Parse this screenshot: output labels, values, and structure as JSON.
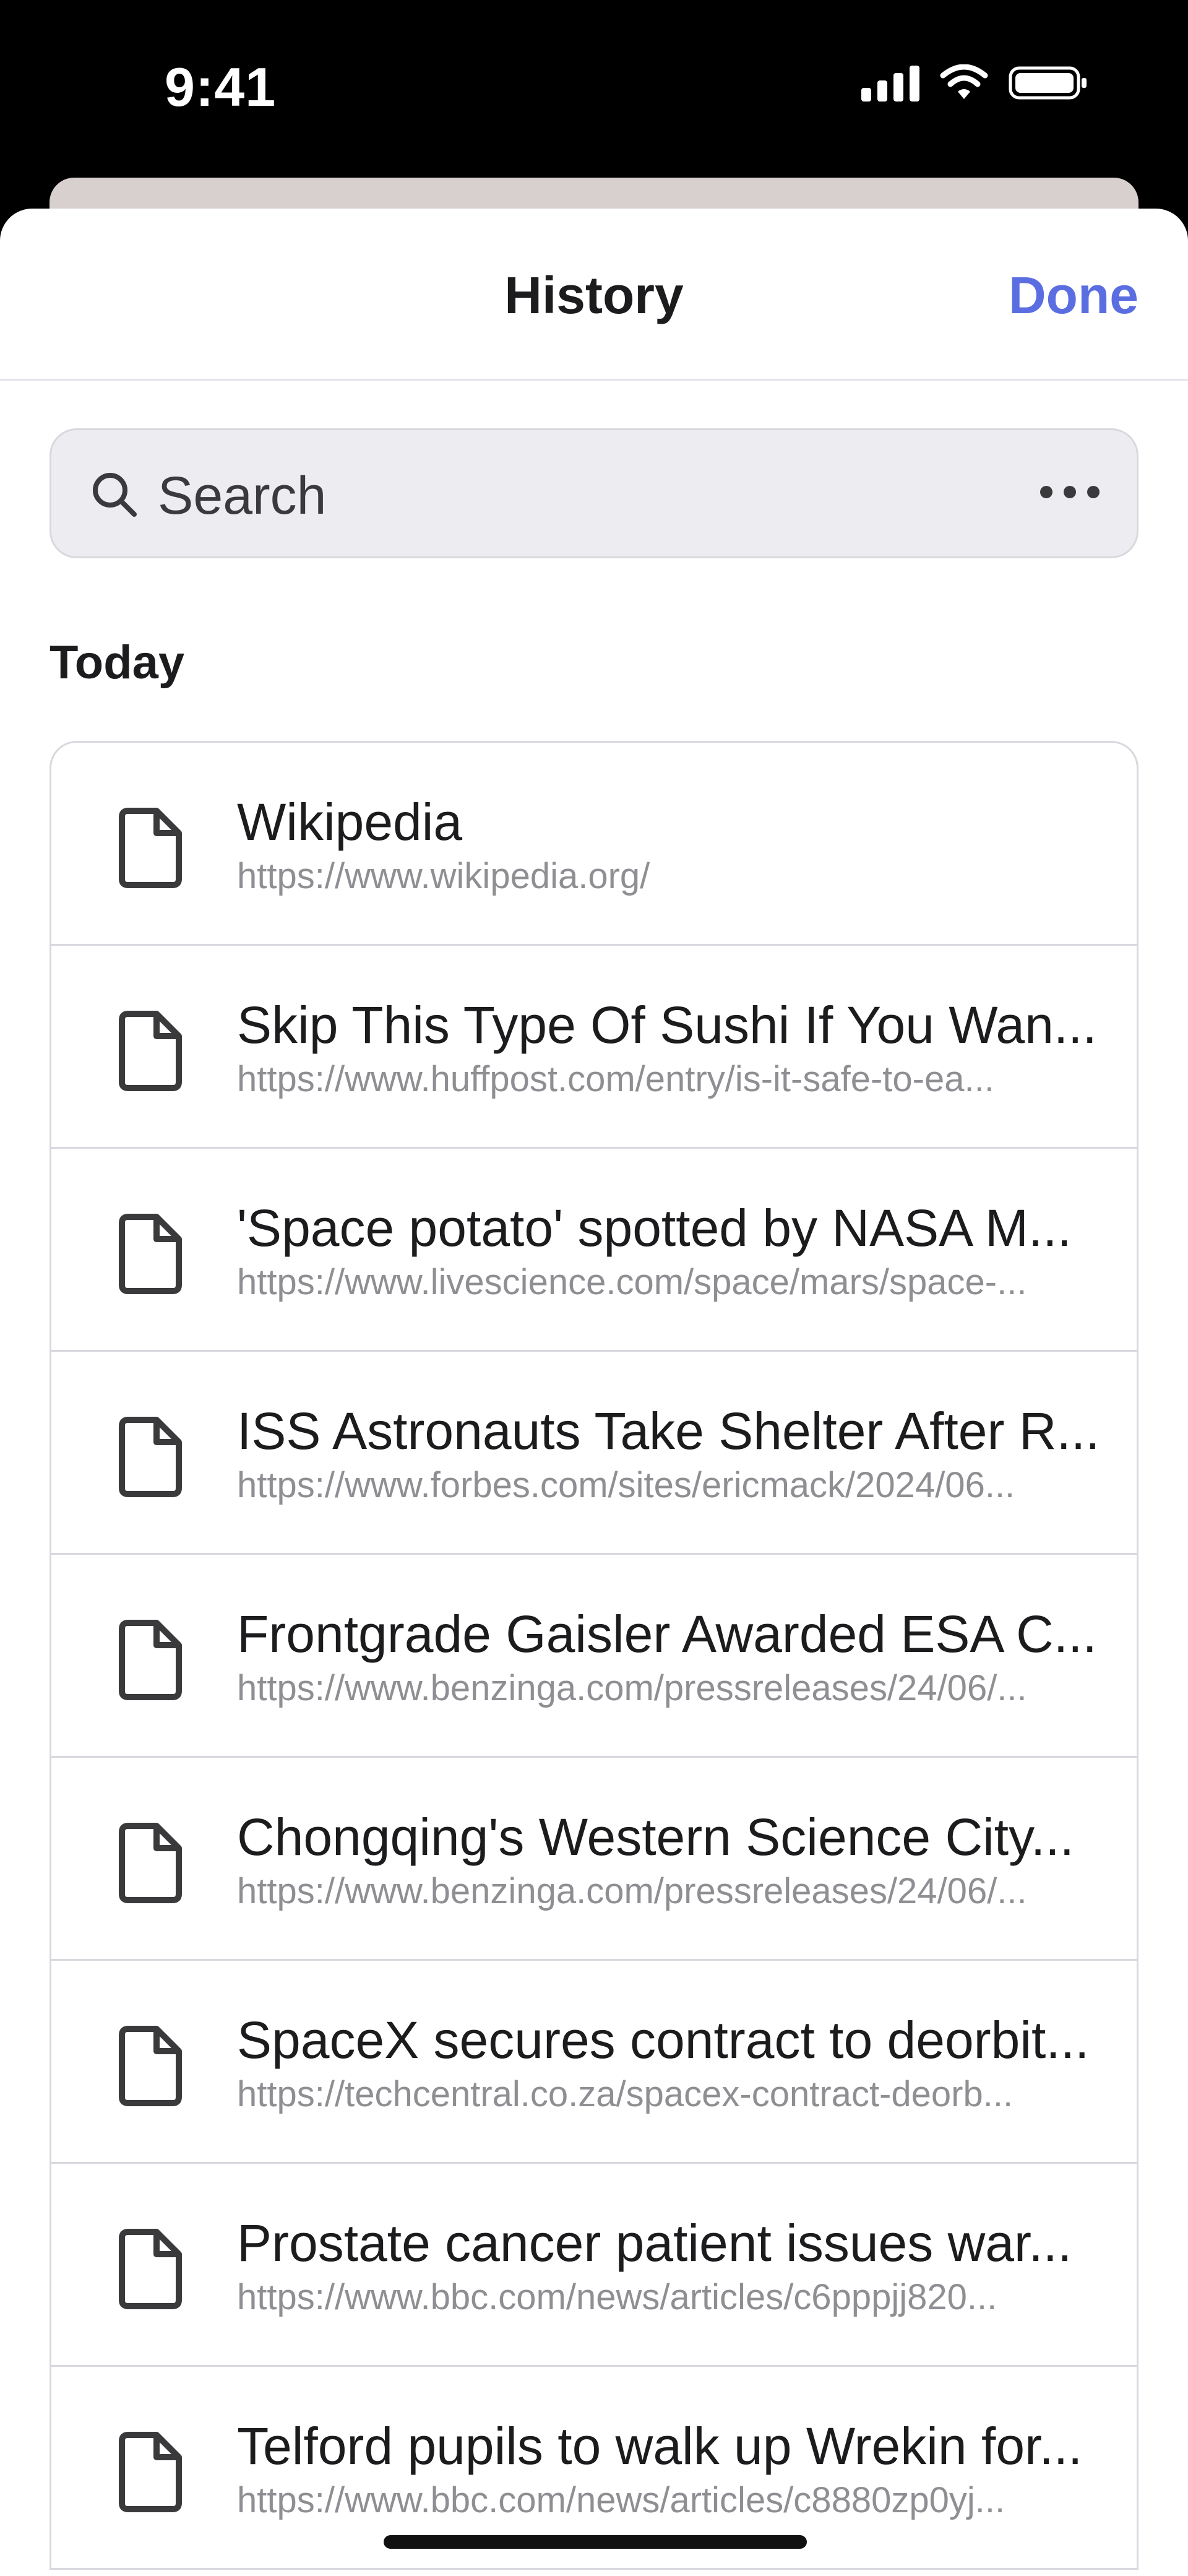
{
  "status_bar": {
    "time": "9:41"
  },
  "nav": {
    "title": "History",
    "done_label": "Done"
  },
  "search": {
    "placeholder": "Search"
  },
  "section": {
    "title": "Today"
  },
  "history": [
    {
      "title": "Wikipedia",
      "url": "https://www.wikipedia.org/"
    },
    {
      "title": "Skip This Type Of Sushi If You Wan...",
      "url": "https://www.huffpost.com/entry/is-it-safe-to-ea..."
    },
    {
      "title": "'Space potato' spotted by NASA M...",
      "url": "https://www.livescience.com/space/mars/space-..."
    },
    {
      "title": "ISS Astronauts Take Shelter After R...",
      "url": "https://www.forbes.com/sites/ericmack/2024/06..."
    },
    {
      "title": "Frontgrade Gaisler Awarded ESA C...",
      "url": "https://www.benzinga.com/pressreleases/24/06/..."
    },
    {
      "title": "Chongqing's Western Science City...",
      "url": "https://www.benzinga.com/pressreleases/24/06/..."
    },
    {
      "title": "SpaceX secures contract to deorbit...",
      "url": "https://techcentral.co.za/spacex-contract-deorb..."
    },
    {
      "title": "Prostate cancer patient issues war...",
      "url": "https://www.bbc.com/news/articles/c6pppjj820..."
    },
    {
      "title": "Telford pupils to walk up Wrekin for...",
      "url": "https://www.bbc.com/news/articles/c8880zp0yj..."
    }
  ],
  "icons": {
    "document": "document-icon",
    "search": "search-icon",
    "more": "more-icon"
  },
  "colors": {
    "accent": "#5b6ee1",
    "secondary_text": "#8e8e93"
  }
}
